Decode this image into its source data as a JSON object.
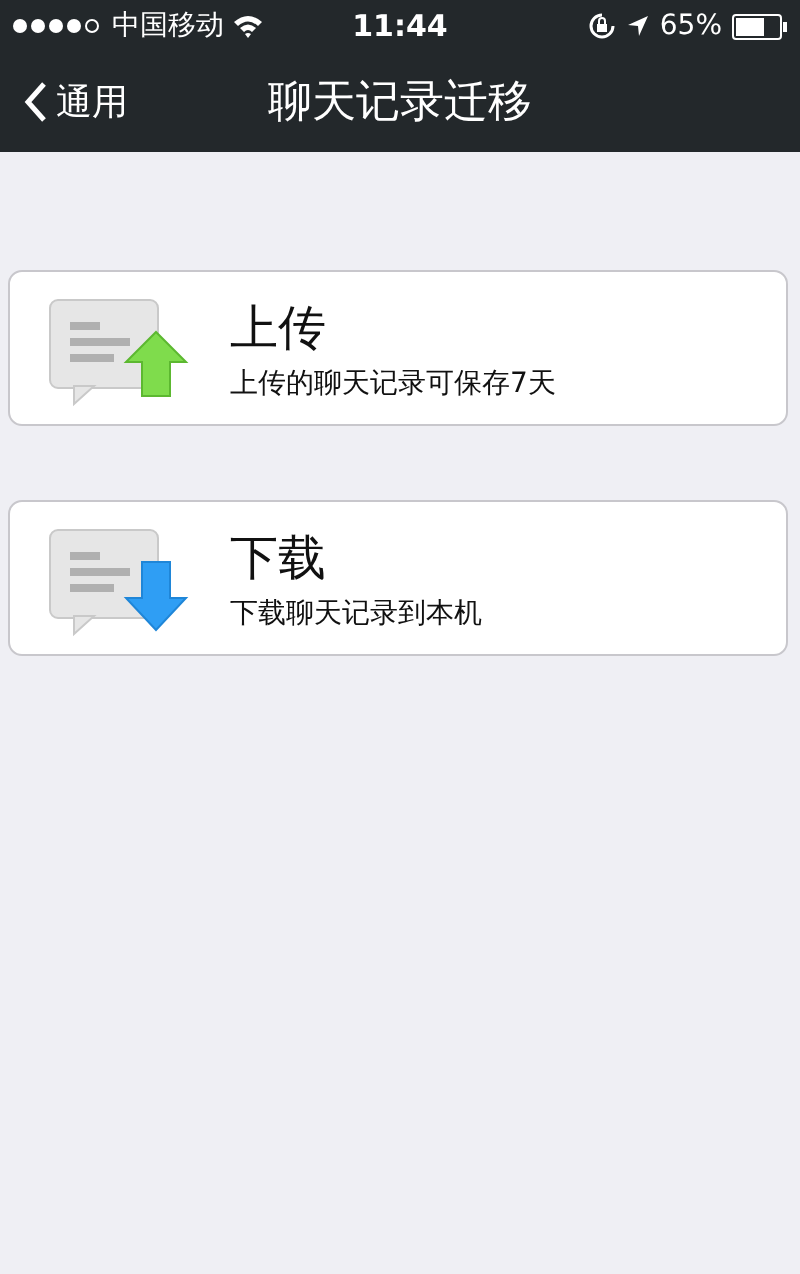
{
  "status_bar": {
    "carrier": "中国移动",
    "time": "11:44",
    "battery": "65%"
  },
  "nav_bar": {
    "back": "通用",
    "title": "聊天记录迁移"
  },
  "items": [
    {
      "kind": "upload",
      "title": "上传",
      "subtitle": "上传的聊天记录可保存7天"
    },
    {
      "kind": "download",
      "title": "下载",
      "subtitle": "下载聊天记录到本机"
    }
  ]
}
